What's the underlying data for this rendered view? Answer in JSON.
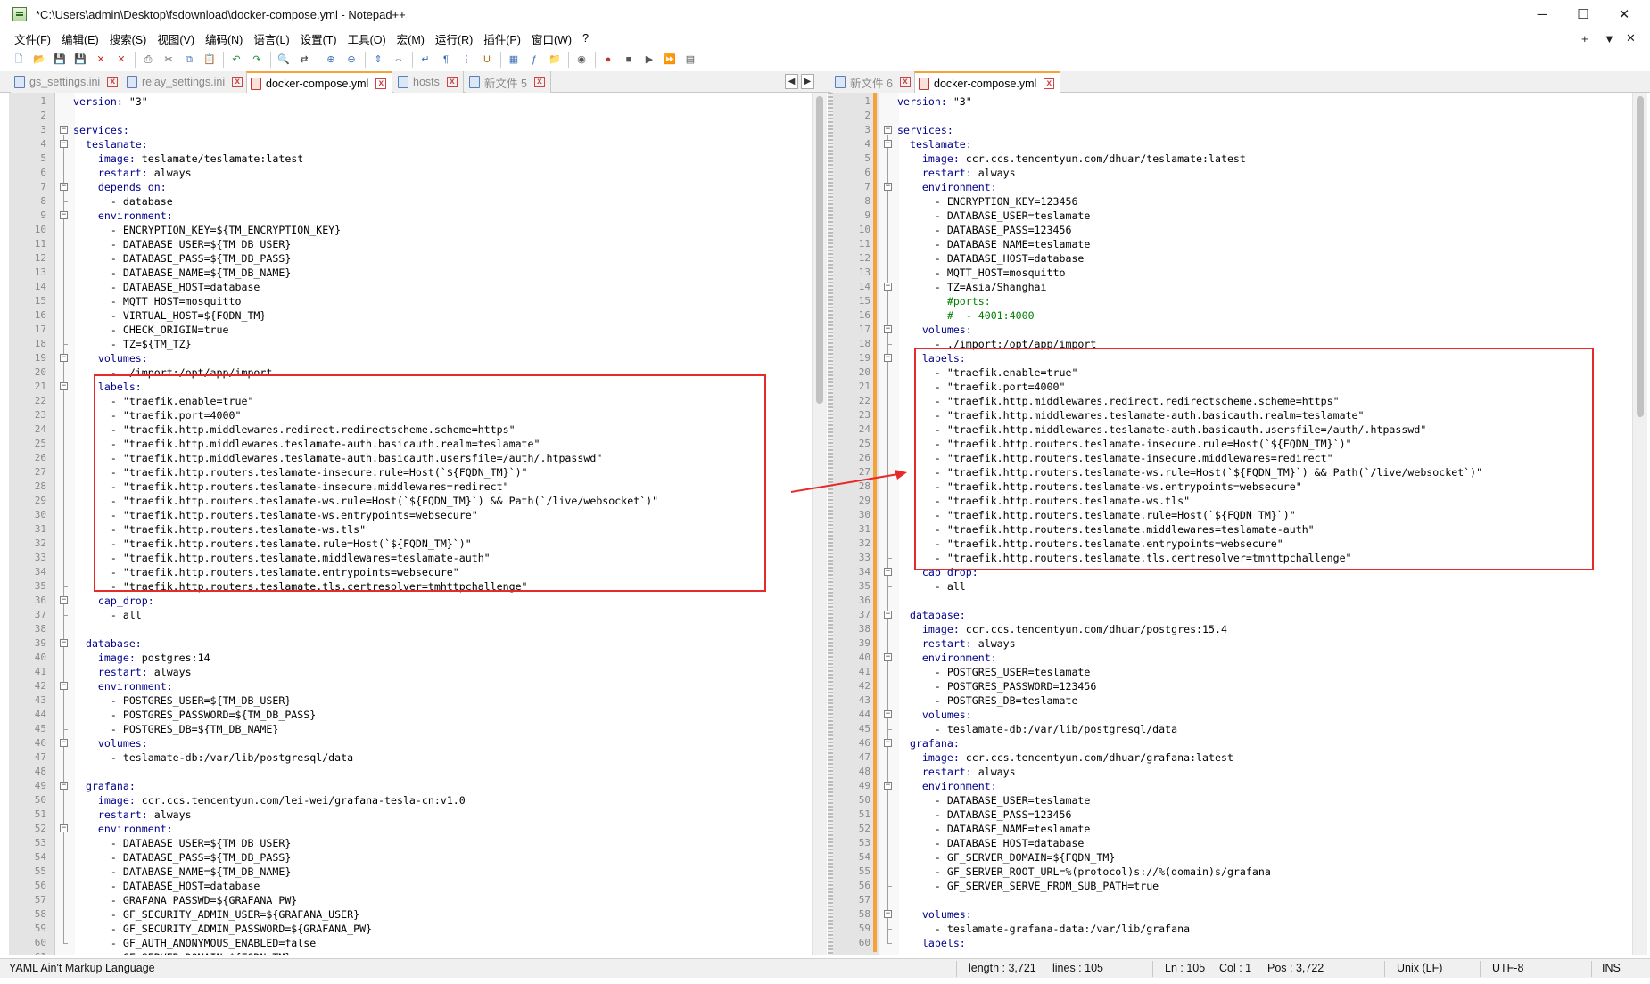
{
  "window": {
    "title": "*C:\\Users\\admin\\Desktop\\fsdownload\\docker-compose.yml - Notepad++",
    "minimize": "─",
    "maximize": "☐",
    "close": "✕"
  },
  "menu": [
    "文件(F)",
    "编辑(E)",
    "搜索(S)",
    "视图(V)",
    "编码(N)",
    "语言(L)",
    "设置(T)",
    "工具(O)",
    "宏(M)",
    "运行(R)",
    "插件(P)",
    "窗口(W)",
    "?"
  ],
  "menu_right": {
    "plus": "+",
    "down": "▼",
    "close": "✕"
  },
  "toolbar_icons": [
    "new-file-icon",
    "open-file-icon",
    "save-icon",
    "save-all-icon",
    "close-icon",
    "close-all-icon",
    "print-icon",
    "cut-icon",
    "copy-icon",
    "paste-icon",
    "undo-icon",
    "redo-icon",
    "find-icon",
    "replace-icon",
    "zoom-in-icon",
    "zoom-out-icon",
    "sync-v-icon",
    "sync-h-icon",
    "word-wrap-icon",
    "show-all-icon",
    "indent-guide-icon",
    "udl-icon",
    "doc-map-icon",
    "function-list-icon",
    "folder-workspace-icon",
    "monitor-icon",
    "record-icon",
    "stop-icon",
    "play-icon",
    "play-multi-icon",
    "save-macro-icon"
  ],
  "left_tabs": [
    {
      "label": "gs_settings.ini",
      "active": false
    },
    {
      "label": "relay_settings.ini",
      "active": false
    },
    {
      "label": "docker-compose.yml",
      "active": true
    },
    {
      "label": "hosts",
      "active": false
    },
    {
      "label": "新文件 5",
      "active": false
    }
  ],
  "right_tabs": [
    {
      "label": "新文件 6",
      "active": false
    },
    {
      "label": "docker-compose.yml",
      "active": true
    }
  ],
  "tab_close": "x",
  "tab_nav": {
    "prev": "◀",
    "next": "▶"
  },
  "left_code": [
    "version: \"3\"",
    "",
    "services:",
    "  teslamate:",
    "    image: teslamate/teslamate:latest",
    "    restart: always",
    "    depends_on:",
    "      - database",
    "    environment:",
    "      - ENCRYPTION_KEY=${TM_ENCRYPTION_KEY}",
    "      - DATABASE_USER=${TM_DB_USER}",
    "      - DATABASE_PASS=${TM_DB_PASS}",
    "      - DATABASE_NAME=${TM_DB_NAME}",
    "      - DATABASE_HOST=database",
    "      - MQTT_HOST=mosquitto",
    "      - VIRTUAL_HOST=${FQDN_TM}",
    "      - CHECK_ORIGIN=true",
    "      - TZ=${TM_TZ}",
    "    volumes:",
    "      - ./import:/opt/app/import",
    "    labels:",
    "      - \"traefik.enable=true\"",
    "      - \"traefik.port=4000\"",
    "      - \"traefik.http.middlewares.redirect.redirectscheme.scheme=https\"",
    "      - \"traefik.http.middlewares.teslamate-auth.basicauth.realm=teslamate\"",
    "      - \"traefik.http.middlewares.teslamate-auth.basicauth.usersfile=/auth/.htpasswd\"",
    "      - \"traefik.http.routers.teslamate-insecure.rule=Host(`${FQDN_TM}`)\"",
    "      - \"traefik.http.routers.teslamate-insecure.middlewares=redirect\"",
    "      - \"traefik.http.routers.teslamate-ws.rule=Host(`${FQDN_TM}`) && Path(`/live/websocket`)\"",
    "      - \"traefik.http.routers.teslamate-ws.entrypoints=websecure\"",
    "      - \"traefik.http.routers.teslamate-ws.tls\"",
    "      - \"traefik.http.routers.teslamate.rule=Host(`${FQDN_TM}`)\"",
    "      - \"traefik.http.routers.teslamate.middlewares=teslamate-auth\"",
    "      - \"traefik.http.routers.teslamate.entrypoints=websecure\"",
    "      - \"traefik.http.routers.teslamate.tls.certresolver=tmhttpchallenge\"",
    "    cap_drop:",
    "      - all",
    "",
    "  database:",
    "    image: postgres:14",
    "    restart: always",
    "    environment:",
    "      - POSTGRES_USER=${TM_DB_USER}",
    "      - POSTGRES_PASSWORD=${TM_DB_PASS}",
    "      - POSTGRES_DB=${TM_DB_NAME}",
    "    volumes:",
    "      - teslamate-db:/var/lib/postgresql/data",
    "",
    "  grafana:",
    "    image: ccr.ccs.tencentyun.com/lei-wei/grafana-tesla-cn:v1.0",
    "    restart: always",
    "    environment:",
    "      - DATABASE_USER=${TM_DB_USER}",
    "      - DATABASE_PASS=${TM_DB_PASS}",
    "      - DATABASE_NAME=${TM_DB_NAME}",
    "      - DATABASE_HOST=database",
    "      - GRAFANA_PASSWD=${GRAFANA_PW}",
    "      - GF_SECURITY_ADMIN_USER=${GRAFANA_USER}",
    "      - GF_SECURITY_ADMIN_PASSWORD=${GRAFANA_PW}",
    "      - GF_AUTH_ANONYMOUS_ENABLED=false",
    "      - GF_SERVER_DOMAIN=${FQDN_TM}"
  ],
  "right_code": [
    "version: \"3\"",
    "",
    "services:",
    "  teslamate:",
    "    image: ccr.ccs.tencentyun.com/dhuar/teslamate:latest",
    "    restart: always",
    "    environment:",
    "      - ENCRYPTION_KEY=123456",
    "      - DATABASE_USER=teslamate",
    "      - DATABASE_PASS=123456",
    "      - DATABASE_NAME=teslamate",
    "      - DATABASE_HOST=database",
    "      - MQTT_HOST=mosquitto",
    "      - TZ=Asia/Shanghai",
    "        #ports:",
    "        #  - 4001:4000",
    "    volumes:",
    "      - ./import:/opt/app/import",
    "    labels:",
    "      - \"traefik.enable=true\"",
    "      - \"traefik.port=4000\"",
    "      - \"traefik.http.middlewares.redirect.redirectscheme.scheme=https\"",
    "      - \"traefik.http.middlewares.teslamate-auth.basicauth.realm=teslamate\"",
    "      - \"traefik.http.middlewares.teslamate-auth.basicauth.usersfile=/auth/.htpasswd\"",
    "      - \"traefik.http.routers.teslamate-insecure.rule=Host(`${FQDN_TM}`)\"",
    "      - \"traefik.http.routers.teslamate-insecure.middlewares=redirect\"",
    "      - \"traefik.http.routers.teslamate-ws.rule=Host(`${FQDN_TM}`) && Path(`/live/websocket`)\"",
    "      - \"traefik.http.routers.teslamate-ws.entrypoints=websecure\"",
    "      - \"traefik.http.routers.teslamate-ws.tls\"",
    "      - \"traefik.http.routers.teslamate.rule=Host(`${FQDN_TM}`)\"",
    "      - \"traefik.http.routers.teslamate.middlewares=teslamate-auth\"",
    "      - \"traefik.http.routers.teslamate.entrypoints=websecure\"",
    "      - \"traefik.http.routers.teslamate.tls.certresolver=tmhttpchallenge\"",
    "    cap_drop:",
    "      - all",
    "",
    "  database:",
    "    image: ccr.ccs.tencentyun.com/dhuar/postgres:15.4",
    "    restart: always",
    "    environment:",
    "      - POSTGRES_USER=teslamate",
    "      - POSTGRES_PASSWORD=123456",
    "      - POSTGRES_DB=teslamate",
    "    volumes:",
    "      - teslamate-db:/var/lib/postgresql/data",
    "  grafana:",
    "    image: ccr.ccs.tencentyun.com/dhuar/grafana:latest",
    "    restart: always",
    "    environment:",
    "      - DATABASE_USER=teslamate",
    "      - DATABASE_PASS=123456",
    "      - DATABASE_NAME=teslamate",
    "      - DATABASE_HOST=database",
    "      - GF_SERVER_DOMAIN=${FQDN_TM}",
    "      - GF_SERVER_ROOT_URL=%(protocol)s://%(domain)s/grafana",
    "      - GF_SERVER_SERVE_FROM_SUB_PATH=true",
    "",
    "    volumes:",
    "      - teslamate-grafana-data:/var/lib/grafana",
    "    labels:"
  ],
  "status": {
    "language": "YAML Ain't Markup Language",
    "length": "length : 3,721",
    "lines": "lines : 105",
    "ln": "Ln : 105",
    "col": "Col : 1",
    "pos": "Pos : 3,722",
    "eol": "Unix (LF)",
    "encoding": "UTF-8",
    "mode": "INS"
  },
  "colors": {
    "highlight_box": "#e62a2a",
    "active_tab_accent": "#f7a136",
    "key": "#00008b",
    "comment": "#008000"
  }
}
